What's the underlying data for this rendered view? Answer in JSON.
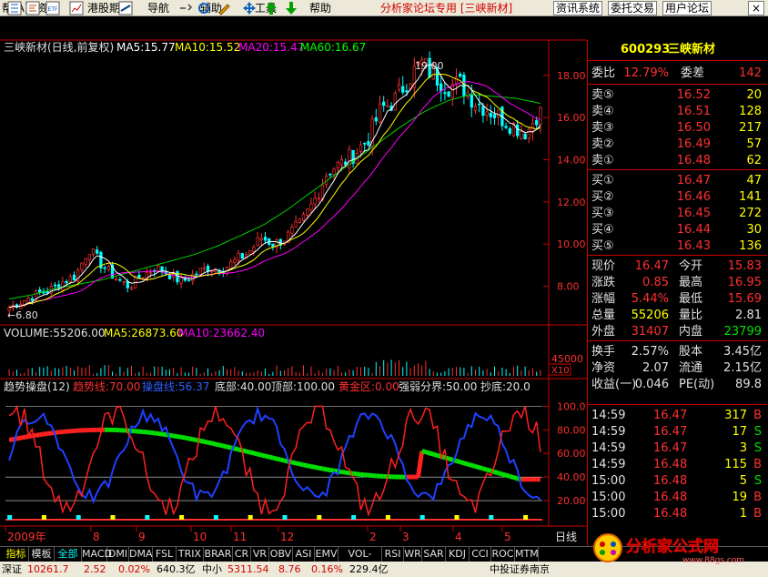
{
  "menu": {
    "items": [
      "帮(A)",
      "资讯",
      "港股期货",
      "导航",
      "辅助",
      "工具",
      "帮助"
    ],
    "forum": "分析家论坛专用 [三峡新材]",
    "buttons": [
      "资讯系统",
      "委托交易",
      "用户论坛"
    ]
  },
  "toolbar_icons": [
    "grid-icon",
    "settings-icon",
    "etf-icon",
    "chart-icon",
    "dragon-icon",
    "reset-icon",
    "add-icon",
    "pen-icon",
    "move-icon",
    "up-arrow-icon",
    "down-arrow-icon"
  ],
  "kline": {
    "title": "三峡新材(日线,前复权)",
    "ma5": "MA5:15.77",
    "ma10": "MA10:15.52",
    "ma20": "MA20:15.47",
    "ma60": "MA60:16.67",
    "high_mark": "19.00",
    "low_mark": "6.80",
    "ticks": [
      "18.00",
      "16.00",
      "14.00",
      "12.00",
      "10.00",
      "8.00"
    ],
    "colors": {
      "ma5": "#ffffff",
      "ma10": "#ffff00",
      "ma20": "#ff00ff",
      "ma60": "#00ff00",
      "up": "#ff3030",
      "down": "#00ffff"
    }
  },
  "chart_data": {
    "type": "candlestick",
    "title": "三峡新材(日线,前复权)",
    "y_ticks": [
      18,
      16,
      14,
      12,
      10,
      8
    ],
    "ylim": [
      6.3,
      19.5
    ],
    "high": 19.0,
    "low": 6.8,
    "last": 16.47,
    "x_labels": [
      "2009年",
      "8",
      "9",
      "10",
      "11",
      "12",
      "2",
      "3",
      "4",
      "5"
    ],
    "close_path": [
      7.0,
      7.3,
      7.6,
      7.8,
      8.2,
      8.5,
      9.8,
      9.0,
      8.4,
      8.0,
      8.5,
      8.9,
      8.6,
      8.2,
      8.6,
      8.9,
      8.8,
      9.2,
      9.6,
      10.3,
      10.0,
      10.4,
      11.0,
      12.1,
      13.5,
      13.8,
      14.3,
      15.0,
      16.4,
      16.8,
      17.8,
      18.6,
      18.0,
      17.5,
      17.6,
      16.8,
      16.4,
      16.0,
      15.6,
      15.3,
      16.47
    ],
    "ma60_path": [
      7.4,
      7.6,
      7.9,
      8.1,
      8.3,
      8.6,
      8.9,
      9.2,
      9.5,
      9.9,
      10.4,
      10.9,
      11.6,
      12.4,
      13.2,
      14.0,
      14.8,
      15.6,
      16.3,
      16.8,
      17.1,
      17.0,
      16.9,
      16.67
    ]
  },
  "volume": {
    "label": "VOLUME:55206.00",
    "ma5": "MA5:26873.60",
    "ma10": "MA10:23662.40",
    "tick": "45000",
    "unit": "X10"
  },
  "indicator": {
    "name": "趋势操盘(12)",
    "trend": "趋势线:70.00",
    "operate": "操盘线:56.37",
    "bottom": "底部:40.00",
    "top": "顶部:100.00",
    "gold": "黄金区:0.00",
    "strength": "强弱分界:50.00",
    "bargain": "抄底:20.0",
    "ticks": [
      "100.0",
      "80.00",
      "60.00",
      "40.00",
      "20.00"
    ]
  },
  "xaxis": {
    "labels": [
      "2009年",
      "8",
      "9",
      "10",
      "11",
      "12",
      "2",
      "3",
      "4",
      "5"
    ],
    "period": "日线"
  },
  "quote": {
    "code": "600293",
    "name": "三峡新材",
    "weibi_label": "委比",
    "weibi": "12.79%",
    "weicha_label": "委差",
    "weicha": "142",
    "sell": [
      {
        "label": "卖⑤",
        "price": "16.52",
        "vol": "20"
      },
      {
        "label": "卖④",
        "price": "16.51",
        "vol": "128"
      },
      {
        "label": "卖③",
        "price": "16.50",
        "vol": "217"
      },
      {
        "label": "卖②",
        "price": "16.49",
        "vol": "57"
      },
      {
        "label": "卖①",
        "price": "16.48",
        "vol": "62"
      }
    ],
    "buy": [
      {
        "label": "买①",
        "price": "16.47",
        "vol": "47"
      },
      {
        "label": "买②",
        "price": "16.46",
        "vol": "141"
      },
      {
        "label": "买③",
        "price": "16.45",
        "vol": "272"
      },
      {
        "label": "买④",
        "price": "16.44",
        "vol": "30"
      },
      {
        "label": "买⑤",
        "price": "16.43",
        "vol": "136"
      }
    ],
    "stats": [
      {
        "l1": "现价",
        "v1": "16.47",
        "c1": "red",
        "l2": "今开",
        "v2": "15.83",
        "c2": "red"
      },
      {
        "l1": "涨跌",
        "v1": "0.85",
        "c1": "red",
        "l2": "最高",
        "v2": "16.95",
        "c2": "red"
      },
      {
        "l1": "涨幅",
        "v1": "5.44%",
        "c1": "red",
        "l2": "最低",
        "v2": "15.69",
        "c2": "red"
      },
      {
        "l1": "总量",
        "v1": "55206",
        "c1": "yel",
        "l2": "量比",
        "v2": "2.81",
        "c2": "wht"
      },
      {
        "l1": "外盘",
        "v1": "31407",
        "c1": "red",
        "l2": "内盘",
        "v2": "23799",
        "c2": "grn"
      },
      {
        "l1": "换手",
        "v1": "2.57%",
        "c1": "wht",
        "l2": "股本",
        "v2": "3.45亿",
        "c2": "wht"
      },
      {
        "l1": "净资",
        "v1": "2.07",
        "c1": "wht",
        "l2": "流通",
        "v2": "2.15亿",
        "c2": "wht"
      },
      {
        "l1": "收益(一)",
        "v1": "0.046",
        "c1": "wht",
        "l2": "PE(动)",
        "v2": "89.8",
        "c2": "wht"
      }
    ],
    "ticks": [
      {
        "time": "14:59",
        "price": "16.47",
        "vol": "317",
        "side": "B"
      },
      {
        "time": "14:59",
        "price": "16.47",
        "vol": "17",
        "side": "S"
      },
      {
        "time": "14:59",
        "price": "16.47",
        "vol": "3",
        "side": "S"
      },
      {
        "time": "14:59",
        "price": "16.48",
        "vol": "115",
        "side": "B"
      },
      {
        "time": "15:00",
        "price": "16.48",
        "vol": "5",
        "side": "S"
      },
      {
        "time": "15:00",
        "price": "16.48",
        "vol": "19",
        "side": "B"
      },
      {
        "time": "15:00",
        "price": "16.48",
        "vol": "1",
        "side": "B"
      }
    ]
  },
  "tabs": [
    "指标",
    "模板",
    "全部",
    "MACD",
    "DMI",
    "DMA",
    "FSL",
    "TRIX",
    "BRAR",
    "CR",
    "VR",
    "OBV",
    "ASI",
    "EMV",
    "VOL-TDX",
    "RSI",
    "WR",
    "SAR",
    "KDJ",
    "CCI",
    "ROC",
    "MTM"
  ],
  "status": {
    "sh_label": "深证",
    "sh_index": "10261.7",
    "sh_change": "2.52",
    "sh_pct": "0.02%",
    "sh_amount": "640.3亿",
    "sz_label": "中小",
    "sz_index": "5311.54",
    "sz_change": "8.76",
    "sz_pct": "0.16%",
    "sz_amount": "229.4亿",
    "broker": "中投证券南京"
  },
  "logo": {
    "brand": "分析家公式网",
    "url": "www.88gs.com"
  }
}
